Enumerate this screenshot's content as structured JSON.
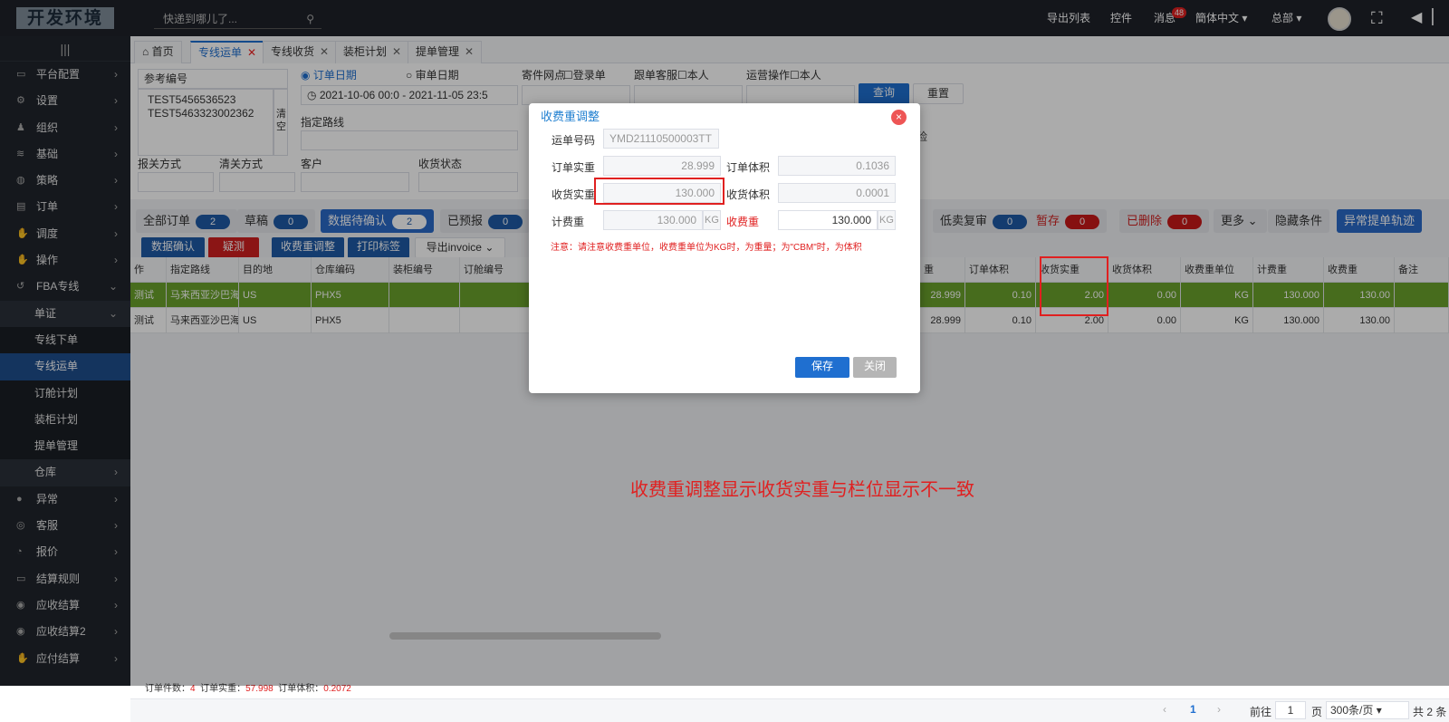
{
  "app": {
    "logo": "开发环境",
    "search_placeholder": "快递到哪儿了...",
    "nav": [
      "导出列表",
      "控件",
      "消息",
      "簡体中文 ▾",
      "总部 ▾"
    ],
    "msg_badge": "48"
  },
  "sidebar": {
    "toggle": "|||",
    "items": [
      {
        "label": "平台配置",
        "icon": "monitor-icon",
        "arrow": "›"
      },
      {
        "label": "设置",
        "icon": "gear-icon",
        "arrow": "›"
      },
      {
        "label": "组织",
        "icon": "people-icon",
        "arrow": "›"
      },
      {
        "label": "基础",
        "icon": "layers-icon",
        "arrow": "›"
      },
      {
        "label": "策略",
        "icon": "chat-icon",
        "arrow": "›"
      },
      {
        "label": "订单",
        "icon": "list-icon",
        "arrow": "›"
      },
      {
        "label": "调度",
        "icon": "hand-icon",
        "arrow": "›"
      },
      {
        "label": "操作",
        "icon": "hand-icon",
        "arrow": "›"
      },
      {
        "label": "FBA专线",
        "icon": "history-icon",
        "arrow": "⌄"
      },
      {
        "label": "单证",
        "icon": "",
        "arrow": "⌄",
        "level": 1
      },
      {
        "label": "专线下单",
        "level": 2
      },
      {
        "label": "专线运单",
        "level": 2,
        "active": true
      },
      {
        "label": "订舱计划",
        "level": 2
      },
      {
        "label": "装柜计划",
        "level": 2
      },
      {
        "label": "提单管理",
        "level": 2
      },
      {
        "label": "仓库",
        "icon": "",
        "arrow": "›",
        "level": 1
      },
      {
        "label": "异常",
        "icon": "alert-icon",
        "arrow": "›"
      },
      {
        "label": "客服",
        "icon": "headset-icon",
        "arrow": "›"
      },
      {
        "label": "报价",
        "icon": "clock-icon",
        "arrow": "›"
      },
      {
        "label": "结算规则",
        "icon": "monitor-icon",
        "arrow": "›"
      },
      {
        "label": "应收结算",
        "icon": "coins-icon",
        "arrow": "›"
      },
      {
        "label": "应收结算2",
        "icon": "coins-icon",
        "arrow": "›"
      },
      {
        "label": "应付结算",
        "icon": "hand-icon",
        "arrow": "›"
      }
    ]
  },
  "tabs": [
    {
      "label": "首页",
      "icon": "⌂"
    },
    {
      "label": "专线运单",
      "active": true
    },
    {
      "label": "专线收货"
    },
    {
      "label": "装柜计划"
    },
    {
      "label": "提单管理"
    }
  ],
  "filters": {
    "ref_type": "参考编号",
    "ref_values": [
      "TEST5456536523",
      "TEST5463323002362"
    ],
    "clear": "清空",
    "order_date": "订单日期",
    "audit_date": "审单日期",
    "date_range": "2021-10-06 00:0  -  2021-11-05 23:5",
    "route": "指定路线",
    "branch": "寄件网点",
    "login_user": "登录单",
    "follow_cs": "跟单客服",
    "self1": "本人",
    "ops": "运营操作",
    "self2": "本人",
    "query": "查询",
    "reset": "重置",
    "risk": "险",
    "declare": "报关方式",
    "clear_method": "清关方式",
    "customer": "客户",
    "receive_status": "收货状态"
  },
  "toolbar": {
    "pills": [
      {
        "label": "全部订单",
        "count": "2"
      },
      {
        "label": "草稿",
        "count": "0"
      },
      {
        "label": "数据待确认",
        "count": "2"
      },
      {
        "label": "已预报",
        "count": "0"
      },
      {
        "label": "低卖复审",
        "count": "0"
      },
      {
        "label": "暂存",
        "count": "0"
      },
      {
        "label": "已删除",
        "count": "0"
      }
    ],
    "more": "更多",
    "hide": "隐藏条件",
    "exception_track": "异常提单轨迹"
  },
  "actions": [
    "数据确认",
    "疑测",
    "收费重调整",
    "打印标签",
    "导出invoice"
  ],
  "grid": {
    "left_headers": [
      "作",
      "指定路线",
      "目的地",
      "仓库编码",
      "装柜编号",
      "订舱编号"
    ],
    "right_headers": [
      "重",
      "订单体积",
      "收货实重",
      "收货体积",
      "收费重单位",
      "计费重",
      "收费重",
      "备注"
    ],
    "rows": [
      {
        "left": [
          "测试",
          "马来西亚沙巴海运",
          "US",
          "PHX5",
          "",
          ""
        ],
        "right": [
          "28.999",
          "0.10",
          "2.00",
          "0.00",
          "KG",
          "130.000",
          "130.00",
          ""
        ]
      },
      {
        "left": [
          "测试",
          "马来西亚沙巴海运",
          "US",
          "PHX5",
          "",
          ""
        ],
        "right": [
          "28.999",
          "0.10",
          "2.00",
          "0.00",
          "KG",
          "130.000",
          "130.00",
          ""
        ]
      }
    ]
  },
  "modal": {
    "title": "收费重调整",
    "close": "×",
    "waybill_label": "运单号码",
    "waybill": "YMD21110500003TT",
    "order_weight_label": "订单实重",
    "order_weight": "28.999",
    "order_volume_label": "订单体积",
    "order_volume": "0.1036",
    "recv_weight_label": "收货实重",
    "recv_weight": "130.000",
    "recv_volume_label": "收货体积",
    "recv_volume": "0.0001",
    "bill_weight_label": "计费重",
    "bill_weight": "130.000",
    "unit1": "KG",
    "charge_weight_label": "收费重",
    "charge_weight": "130.000",
    "unit2": "KG",
    "note": "注意：请注意收费重单位，收费重单位为KG时，为重量；为\"CBM\"时，为体积",
    "save": "保存",
    "cancel": "关闭"
  },
  "annotation": "收费重调整显示收货实重与栏位显示不一致",
  "footer": {
    "count_label": "订单件数：",
    "count": "4",
    "weight_label": "订单实重：",
    "weight": "57.998",
    "volume_label": "订单体积：",
    "volume": "0.2072"
  },
  "pager": {
    "prev": "‹",
    "page": "1",
    "next": "›",
    "goto": "前往",
    "page_input": "1",
    "page_unit": "页",
    "size": "300条/页 ▾",
    "total": "共 2 条"
  }
}
